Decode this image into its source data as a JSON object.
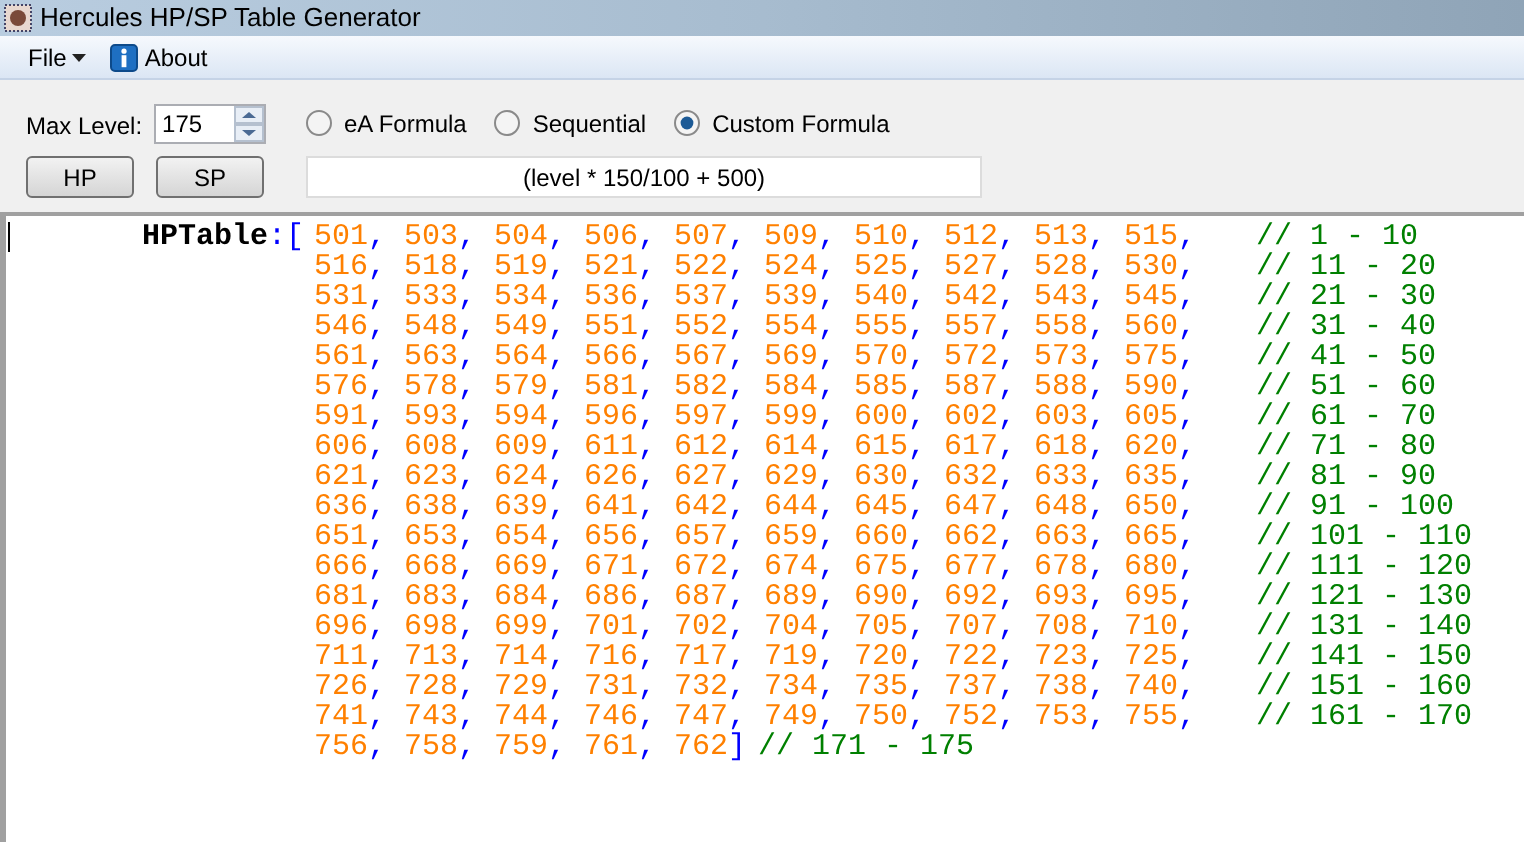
{
  "window": {
    "title": "Hercules HP/SP Table Generator"
  },
  "menu": [
    {
      "label": "File",
      "kind": "dropdown"
    },
    {
      "label": "About",
      "kind": "info"
    }
  ],
  "max_level": {
    "label": "Max Level:",
    "value": "175"
  },
  "formulas": [
    {
      "label": "eA Formula",
      "selected": false
    },
    {
      "label": "Sequential",
      "selected": false
    },
    {
      "label": "Custom Formula",
      "selected": true
    }
  ],
  "buttons": [
    "HP",
    "SP"
  ],
  "formula_field": {
    "value": "(level * 150/100 + 500)"
  },
  "code": {
    "name": "HPTable",
    "open": ":[",
    "close": "]",
    "separator": ",",
    "rows": [
      {
        "values": [
          "501",
          "503",
          "504",
          "506",
          "507",
          "509",
          "510",
          "512",
          "513",
          "515"
        ],
        "comment": "// 1 - 10"
      },
      {
        "values": [
          "516",
          "518",
          "519",
          "521",
          "522",
          "524",
          "525",
          "527",
          "528",
          "530"
        ],
        "comment": "// 11 - 20"
      },
      {
        "values": [
          "531",
          "533",
          "534",
          "536",
          "537",
          "539",
          "540",
          "542",
          "543",
          "545"
        ],
        "comment": "// 21 - 30"
      },
      {
        "values": [
          "546",
          "548",
          "549",
          "551",
          "552",
          "554",
          "555",
          "557",
          "558",
          "560"
        ],
        "comment": "// 31 - 40"
      },
      {
        "values": [
          "561",
          "563",
          "564",
          "566",
          "567",
          "569",
          "570",
          "572",
          "573",
          "575"
        ],
        "comment": "// 41 - 50"
      },
      {
        "values": [
          "576",
          "578",
          "579",
          "581",
          "582",
          "584",
          "585",
          "587",
          "588",
          "590"
        ],
        "comment": "// 51 - 60"
      },
      {
        "values": [
          "591",
          "593",
          "594",
          "596",
          "597",
          "599",
          "600",
          "602",
          "603",
          "605"
        ],
        "comment": "// 61 - 70"
      },
      {
        "values": [
          "606",
          "608",
          "609",
          "611",
          "612",
          "614",
          "615",
          "617",
          "618",
          "620"
        ],
        "comment": "// 71 - 80"
      },
      {
        "values": [
          "621",
          "623",
          "624",
          "626",
          "627",
          "629",
          "630",
          "632",
          "633",
          "635"
        ],
        "comment": "// 81 - 90"
      },
      {
        "values": [
          "636",
          "638",
          "639",
          "641",
          "642",
          "644",
          "645",
          "647",
          "648",
          "650"
        ],
        "comment": "// 91 - 100"
      },
      {
        "values": [
          "651",
          "653",
          "654",
          "656",
          "657",
          "659",
          "660",
          "662",
          "663",
          "665"
        ],
        "comment": "// 101 - 110"
      },
      {
        "values": [
          "666",
          "668",
          "669",
          "671",
          "672",
          "674",
          "675",
          "677",
          "678",
          "680"
        ],
        "comment": "// 111 - 120"
      },
      {
        "values": [
          "681",
          "683",
          "684",
          "686",
          "687",
          "689",
          "690",
          "692",
          "693",
          "695"
        ],
        "comment": "// 121 - 130"
      },
      {
        "values": [
          "696",
          "698",
          "699",
          "701",
          "702",
          "704",
          "705",
          "707",
          "708",
          "710"
        ],
        "comment": "// 131 - 140"
      },
      {
        "values": [
          "711",
          "713",
          "714",
          "716",
          "717",
          "719",
          "720",
          "722",
          "723",
          "725"
        ],
        "comment": "// 141 - 150"
      },
      {
        "values": [
          "726",
          "728",
          "729",
          "731",
          "732",
          "734",
          "735",
          "737",
          "738",
          "740"
        ],
        "comment": "// 151 - 160"
      },
      {
        "values": [
          "741",
          "743",
          "744",
          "746",
          "747",
          "749",
          "750",
          "752",
          "753",
          "755"
        ],
        "comment": "// 161 - 170"
      },
      {
        "values": [
          "756",
          "758",
          "759",
          "761",
          "762"
        ],
        "comment": "// 171 - 175"
      }
    ]
  }
}
